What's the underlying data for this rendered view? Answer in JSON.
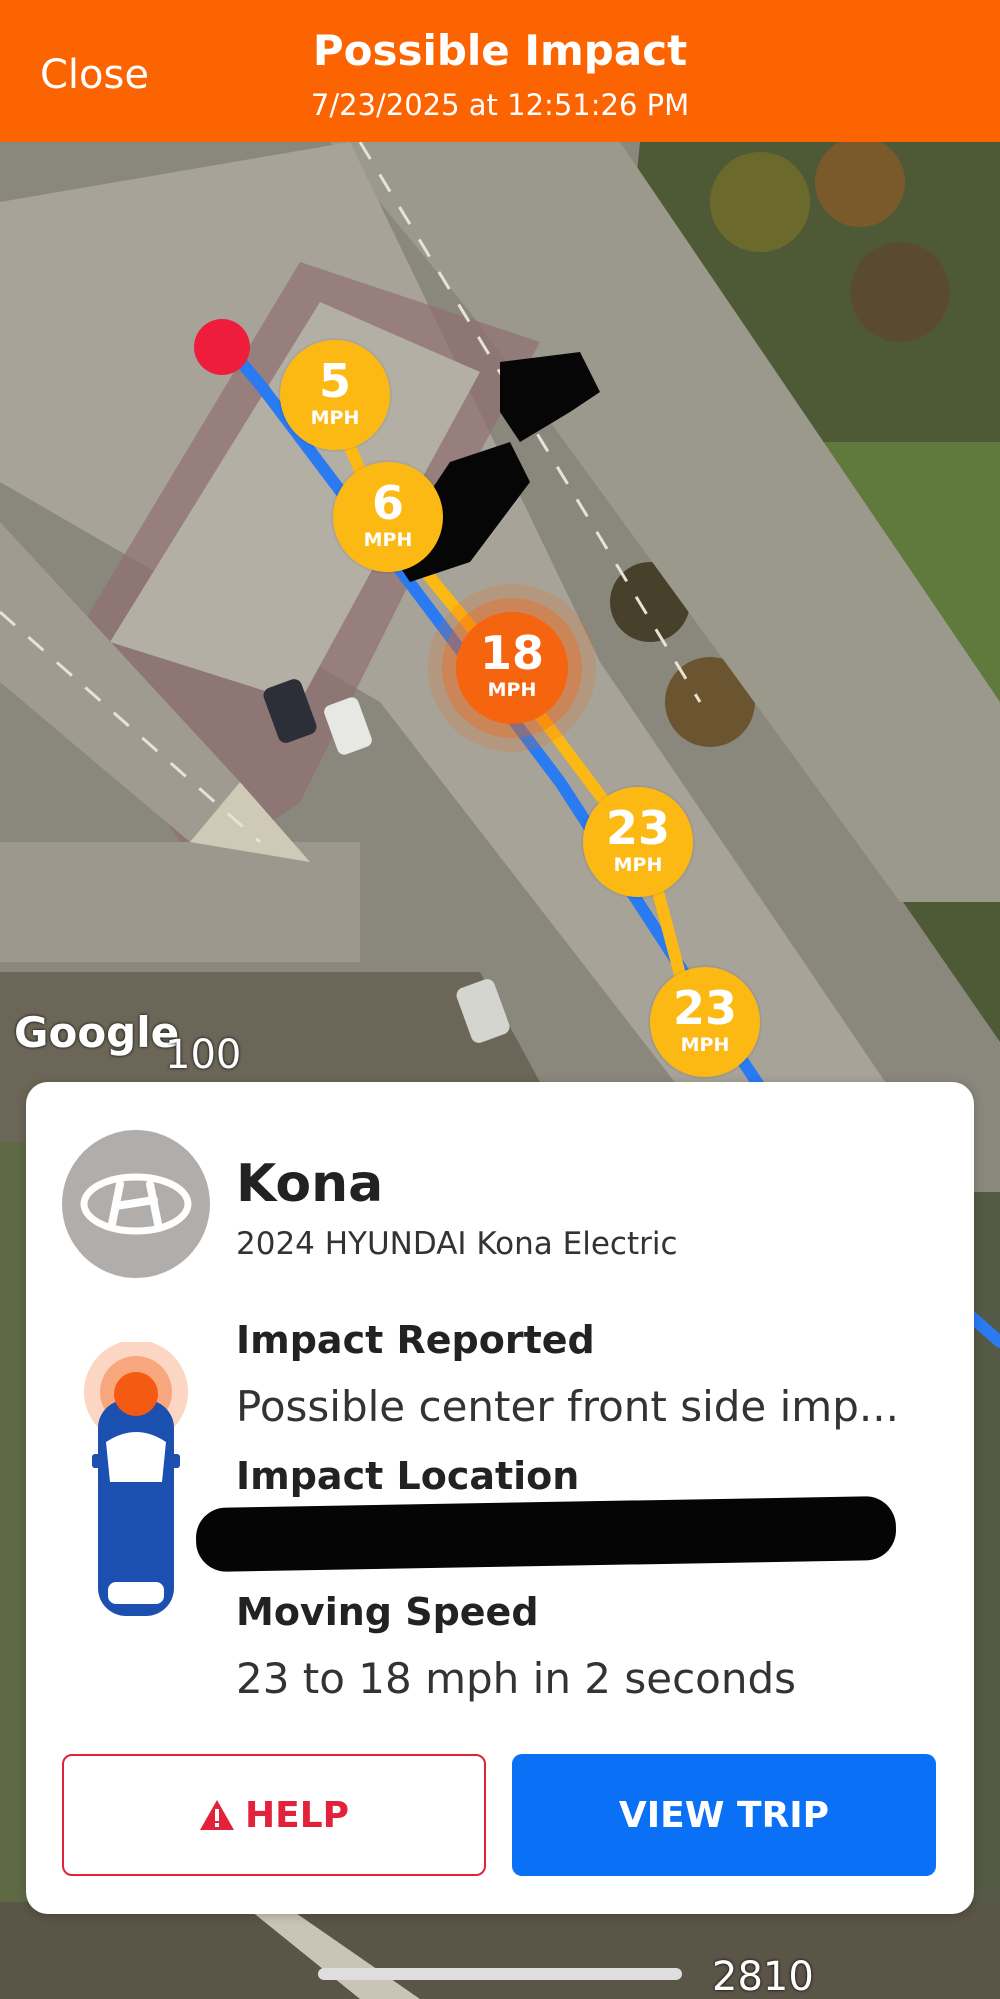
{
  "header": {
    "close_label": "Close",
    "title": "Possible Impact",
    "timestamp": "7/23/2025 at 12:51:26 PM",
    "background_color": "#fb6400"
  },
  "map": {
    "attribution": "Google",
    "road_labels": [
      "100",
      "2810"
    ],
    "route_color": "#2a7af2",
    "speed_markers": [
      {
        "value": "5",
        "unit": "MPH"
      },
      {
        "value": "6",
        "unit": "MPH"
      },
      {
        "value": "18",
        "unit": "MPH",
        "highlight": true
      },
      {
        "value": "23",
        "unit": "MPH"
      },
      {
        "value": "23",
        "unit": "MPH"
      }
    ]
  },
  "vehicle": {
    "name": "Kona",
    "model": "2024 HYUNDAI Kona Electric",
    "logo_icon": "hyundai-logo"
  },
  "details": {
    "impact_reported_label": "Impact Reported",
    "impact_reported_value": "Possible center front side imp...",
    "impact_location_label": "Impact Location",
    "moving_speed_label": "Moving Speed",
    "moving_speed_value": "23 to 18 mph in 2 seconds"
  },
  "actions": {
    "help_label": "HELP",
    "view_trip_label": "VIEW TRIP",
    "help_color": "#e2213a",
    "view_trip_color": "#0a70f5"
  }
}
